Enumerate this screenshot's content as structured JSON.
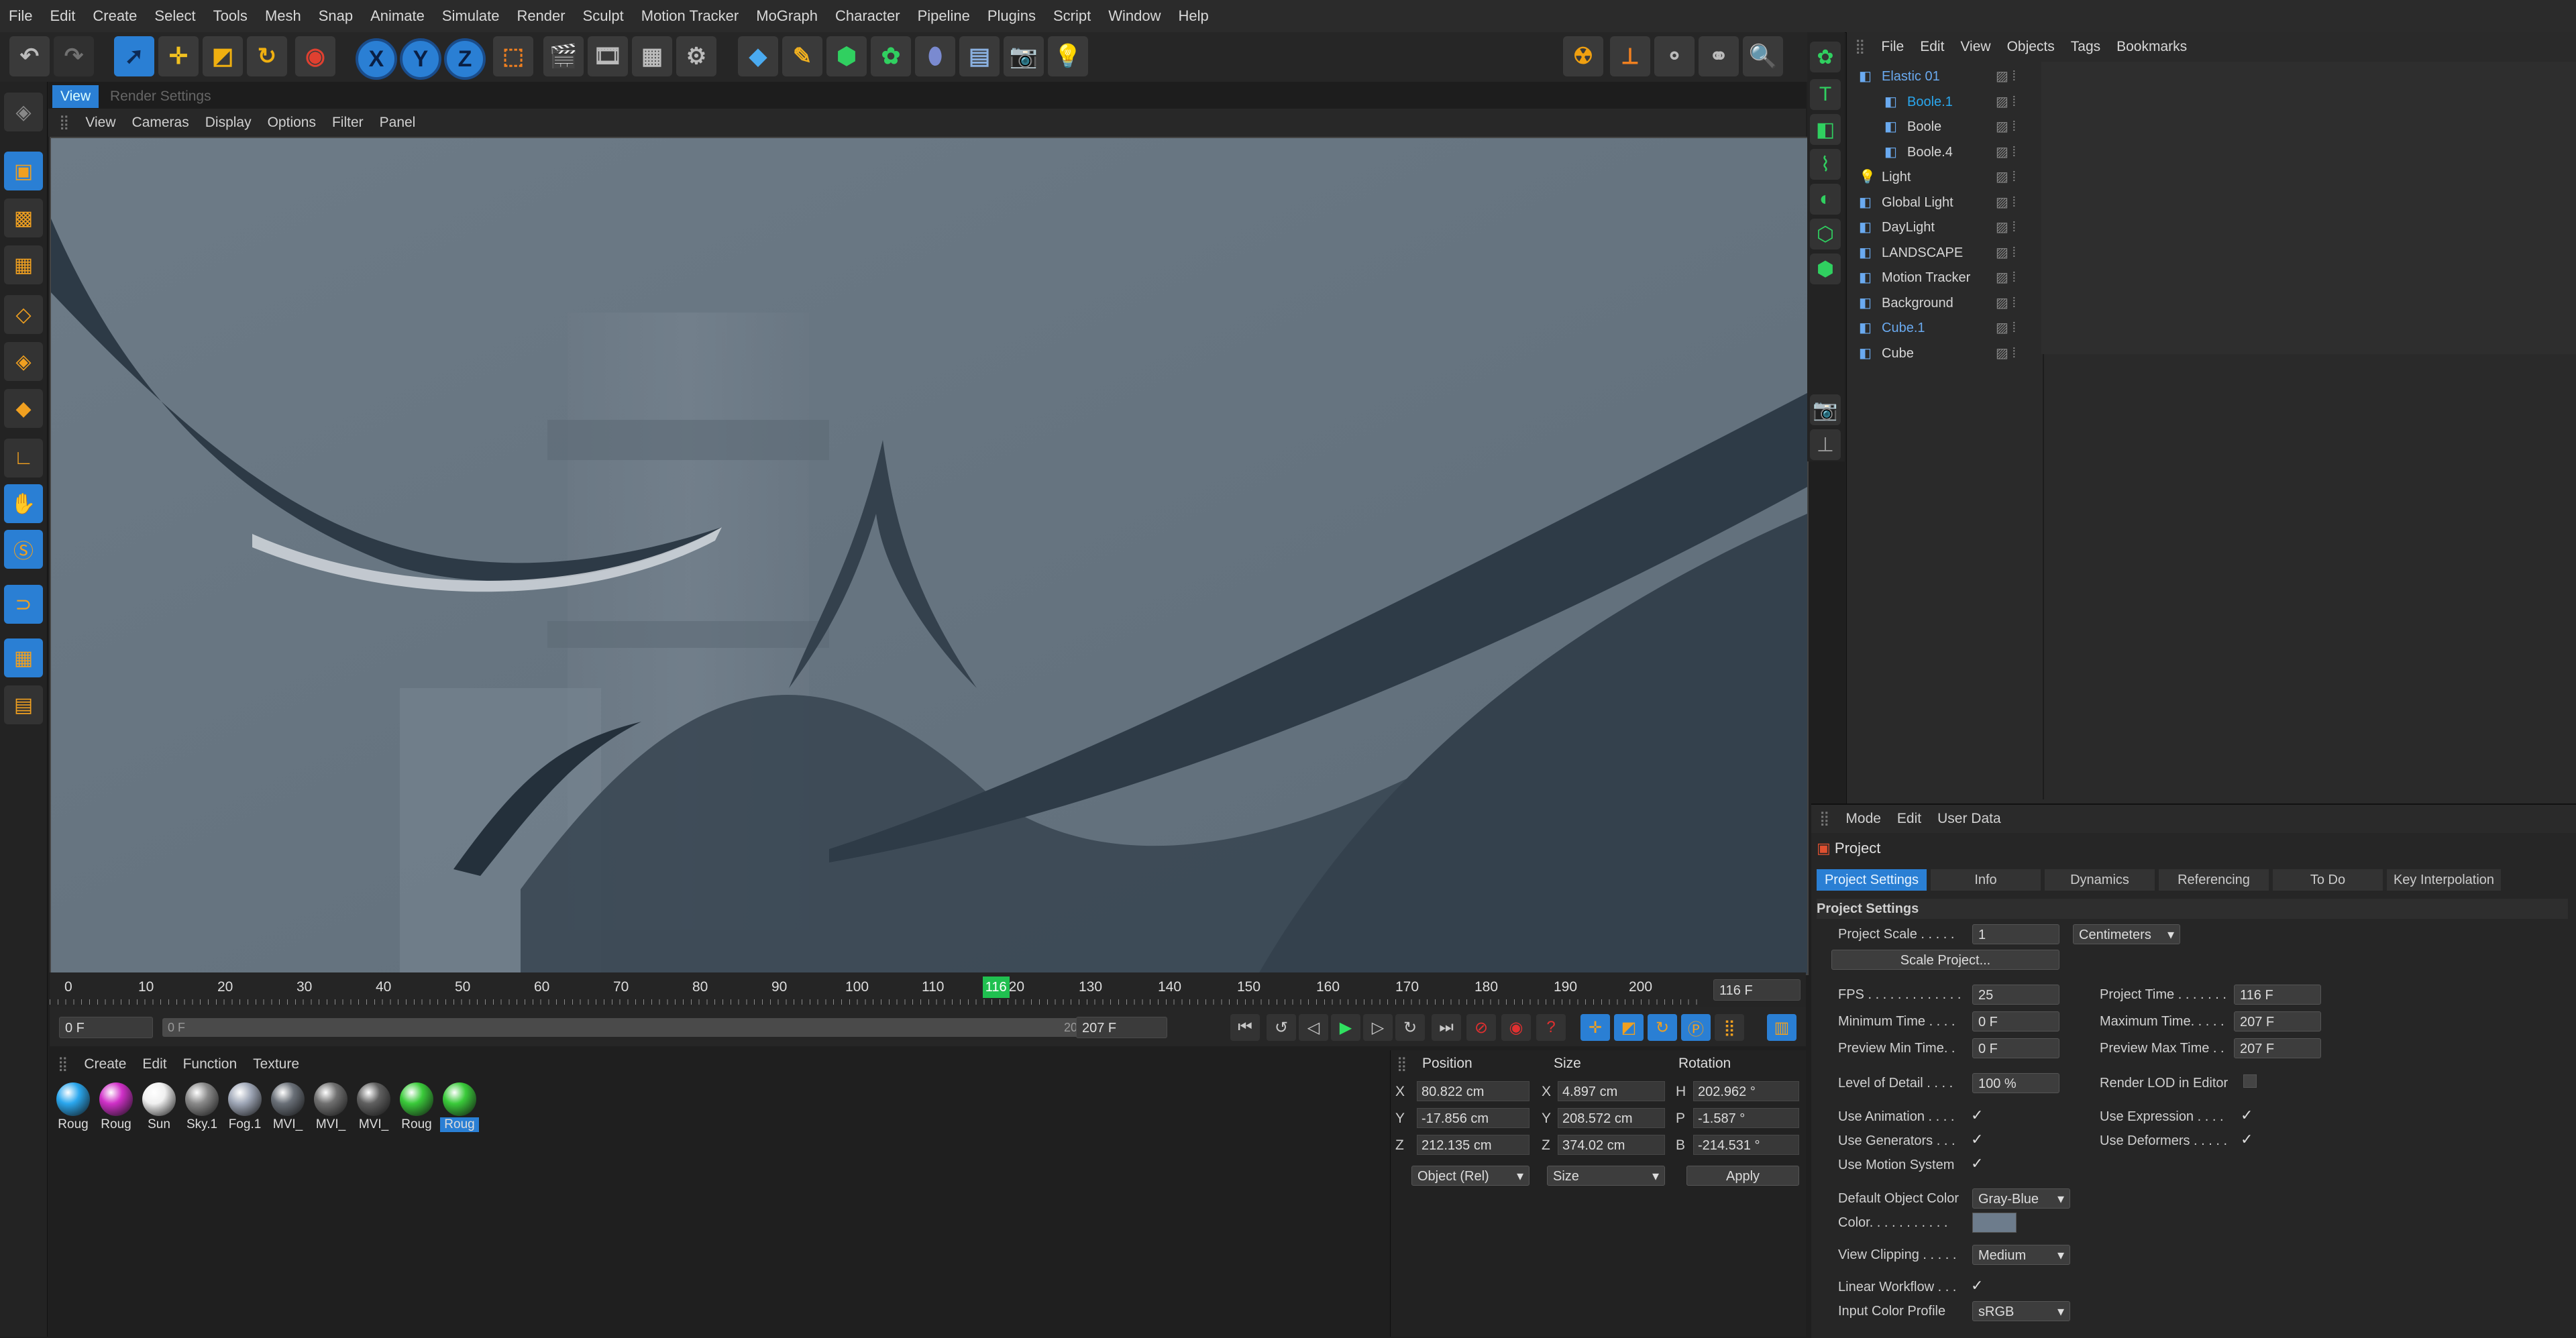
{
  "menubar": [
    "File",
    "Edit",
    "Create",
    "Select",
    "Tools",
    "Mesh",
    "Snap",
    "Animate",
    "Simulate",
    "Render",
    "Sculpt",
    "Motion Tracker",
    "MoGraph",
    "Character",
    "Pipeline",
    "Plugins",
    "Script",
    "Window",
    "Help"
  ],
  "toolbar": {
    "axis_x": "X",
    "axis_y": "Y",
    "axis_z": "Z"
  },
  "viewport_tabs": {
    "view": "View",
    "render_settings": "Render Settings"
  },
  "viewport_menu": [
    "View",
    "Cameras",
    "Display",
    "Options",
    "Filter",
    "Panel"
  ],
  "timeline": {
    "ticks": [
      "0",
      "10",
      "20",
      "30",
      "40",
      "50",
      "60",
      "70",
      "80",
      "90",
      "100",
      "110",
      "120",
      "130",
      "140",
      "150",
      "160",
      "170",
      "180",
      "190",
      "200"
    ],
    "current_frame_marker": "116",
    "current_frame_field": "116 F",
    "current_frame_value": 116,
    "max_frame": 207
  },
  "transport": {
    "start_field": "0 F",
    "range_start": "0 F",
    "range_end": "207 F",
    "end_field": "207 F"
  },
  "material_panel": {
    "menu": [
      "Create",
      "Edit",
      "Function",
      "Texture"
    ],
    "materials": [
      {
        "label": "Roug",
        "color": "#2aa7ee"
      },
      {
        "label": "Roug",
        "color": "#d030c8"
      },
      {
        "label": "Sun",
        "color": "#f0f0f0"
      },
      {
        "label": "Sky.1",
        "color": "#8a8a8a"
      },
      {
        "label": "Fog.1",
        "color": "#a0a8b8"
      },
      {
        "label": "MVI_",
        "color": "#6a7078"
      },
      {
        "label": "MVI_",
        "color": "#707070"
      },
      {
        "label": "MVI_",
        "color": "#606060"
      },
      {
        "label": "Roug",
        "color": "#3acb3a"
      },
      {
        "label": "Roug",
        "color": "#3acb3a"
      }
    ]
  },
  "coordinates": {
    "headers": {
      "position": "Position",
      "size": "Size",
      "rotation": "Rotation"
    },
    "rows": [
      {
        "axis": "X",
        "pos": "80.822 cm",
        "saxis": "X",
        "size": "4.897 cm",
        "raxis": "H",
        "rot": "202.962 °"
      },
      {
        "axis": "Y",
        "pos": "-17.856 cm",
        "saxis": "Y",
        "size": "208.572 cm",
        "raxis": "P",
        "rot": "-1.587 °"
      },
      {
        "axis": "Z",
        "pos": "212.135 cm",
        "saxis": "Z",
        "size": "374.02 cm",
        "raxis": "B",
        "rot": "-214.531 °"
      }
    ],
    "mode_dropdown": "Object (Rel)",
    "size_dropdown": "Size",
    "apply_label": "Apply"
  },
  "object_manager": {
    "menu": [
      "File",
      "Edit",
      "View",
      "Objects",
      "Tags",
      "Bookmarks"
    ],
    "objects": [
      {
        "name": "Elastic 01",
        "color": "#6aaaf0"
      },
      {
        "name": "Boole.1",
        "color": "#2aa7ee"
      },
      {
        "name": "Boole",
        "color": "#d6d6d6"
      },
      {
        "name": "Boole.4",
        "color": "#d6d6d6"
      },
      {
        "name": "Light",
        "color": "#d6d6d6"
      },
      {
        "name": "Global Light",
        "color": "#d6d6d6"
      },
      {
        "name": "DayLight",
        "color": "#d6d6d6"
      },
      {
        "name": "LANDSCAPE",
        "color": "#d6d6d6"
      },
      {
        "name": "Motion Tracker",
        "color": "#d6d6d6"
      },
      {
        "name": "Background",
        "color": "#d6d6d6"
      },
      {
        "name": "Cube.1",
        "color": "#6aaaf0"
      },
      {
        "name": "Cube",
        "color": "#d6d6d6"
      }
    ]
  },
  "attributes": {
    "menu": [
      "Mode",
      "Edit",
      "User Data"
    ],
    "title": "Project",
    "tabs": [
      "Project Settings",
      "Info",
      "Dynamics",
      "Referencing",
      "To Do",
      "Key Interpolation"
    ],
    "section": "Project Settings",
    "project_scale_label": "Project Scale . . . . .",
    "project_scale_value": "1",
    "project_scale_unit": "Centimeters",
    "scale_project_btn": "Scale Project...",
    "fps_label": "FPS . . . . . . . . . . . . .",
    "fps_value": "25",
    "project_time_label": "Project Time . . . . . . .",
    "project_time_value": "116 F",
    "min_time_label": "Minimum Time . . . .",
    "min_time_value": "0 F",
    "max_time_label": "Maximum Time. . . . .",
    "max_time_value": "207 F",
    "preview_min_label": "Preview Min Time. .",
    "preview_min_value": "0 F",
    "preview_max_label": "Preview Max Time . .",
    "preview_max_value": "207 F",
    "lod_label": "Level of Detail . . . .",
    "lod_value": "100 %",
    "render_lod_label": "Render LOD in Editor",
    "use_animation": "Use Animation . . . .",
    "use_expression": "Use Expression . . . .",
    "use_generators": "Use Generators . . .",
    "use_deformers": "Use Deformers . . . . .",
    "use_motion": "Use Motion System",
    "default_color_label": "Default Object Color",
    "default_color_value": "Gray-Blue",
    "color_label": "Color. . . . . . . . . . .",
    "color_swatch": "#6d7c8c",
    "view_clipping_label": "View Clipping . . . . .",
    "view_clipping_value": "Medium",
    "linear_workflow": "Linear Workflow . . .",
    "input_color_label": "Input Color Profile",
    "input_color_value": "sRGB",
    "check": "✓"
  }
}
